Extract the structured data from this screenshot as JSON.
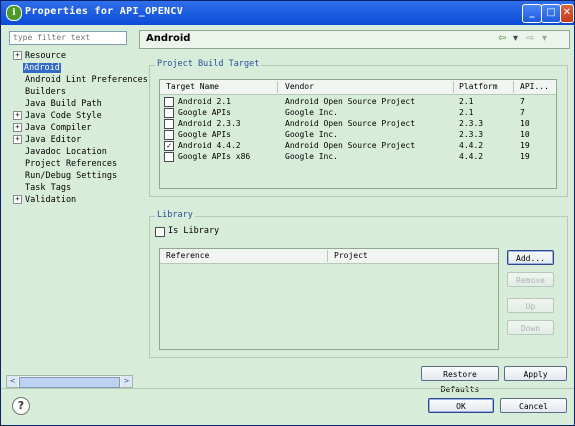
{
  "window": {
    "title": "Properties for API_OPENCV",
    "app_icon": "android-app-icon",
    "title_buttons": [
      {
        "name": "minimize",
        "glyph": "_"
      },
      {
        "name": "maximize",
        "glyph": "□"
      },
      {
        "name": "close",
        "glyph": "✕"
      }
    ]
  },
  "sidebar": {
    "filter_placeholder": "type filter text",
    "items": [
      {
        "label": "Resource",
        "expandable": true,
        "selected": false
      },
      {
        "label": "Android",
        "expandable": false,
        "selected": true
      },
      {
        "label": "Android Lint Preferences",
        "expandable": false,
        "selected": false
      },
      {
        "label": "Builders",
        "expandable": false,
        "selected": false
      },
      {
        "label": "Java Build Path",
        "expandable": false,
        "selected": false
      },
      {
        "label": "Java Code Style",
        "expandable": true,
        "selected": false
      },
      {
        "label": "Java Compiler",
        "expandable": true,
        "selected": false
      },
      {
        "label": "Java Editor",
        "expandable": true,
        "selected": false
      },
      {
        "label": "Javadoc Location",
        "expandable": false,
        "selected": false
      },
      {
        "label": "Project References",
        "expandable": false,
        "selected": false
      },
      {
        "label": "Run/Debug Settings",
        "expandable": false,
        "selected": false
      },
      {
        "label": "Task Tags",
        "expandable": false,
        "selected": false
      },
      {
        "label": "Validation",
        "expandable": true,
        "selected": false
      }
    ],
    "expand_glyph": "+",
    "scroll_left": "<",
    "scroll_right": ">"
  },
  "page": {
    "title": "Android",
    "nav_back_glyph": "⇦",
    "nav_forward_glyph": "⇨",
    "nav_menu_glyph": "▾"
  },
  "build_target": {
    "legend": "Project Build Target",
    "headers": [
      "Target Name",
      "Vendor",
      "Platform",
      "API..."
    ],
    "rows": [
      {
        "checked": false,
        "name": "Android 2.1",
        "vendor": "Android Open Source Project",
        "platform": "2.1",
        "api": "7"
      },
      {
        "checked": false,
        "name": "Google APIs",
        "vendor": "Google Inc.",
        "platform": "2.1",
        "api": "7"
      },
      {
        "checked": false,
        "name": "Android 2.3.3",
        "vendor": "Android Open Source Project",
        "platform": "2.3.3",
        "api": "10"
      },
      {
        "checked": false,
        "name": "Google APIs",
        "vendor": "Google Inc.",
        "platform": "2.3.3",
        "api": "10"
      },
      {
        "checked": true,
        "name": "Android 4.4.2",
        "vendor": "Android Open Source Project",
        "platform": "4.4.2",
        "api": "19"
      },
      {
        "checked": false,
        "name": "Google APIs x86",
        "vendor": "Google Inc.",
        "platform": "4.4.2",
        "api": "19"
      }
    ],
    "check_glyph": "✓"
  },
  "library": {
    "legend": "Library",
    "is_library_label": "Is Library",
    "is_library_checked": false,
    "headers": [
      "Reference",
      "Project"
    ],
    "buttons": {
      "add": "Add...",
      "remove": "Remove",
      "up": "Up",
      "down": "Down"
    }
  },
  "actions": {
    "restore_defaults": "Restore Defaults",
    "apply": "Apply",
    "ok": "OK",
    "cancel": "Cancel",
    "help_glyph": "?"
  }
}
